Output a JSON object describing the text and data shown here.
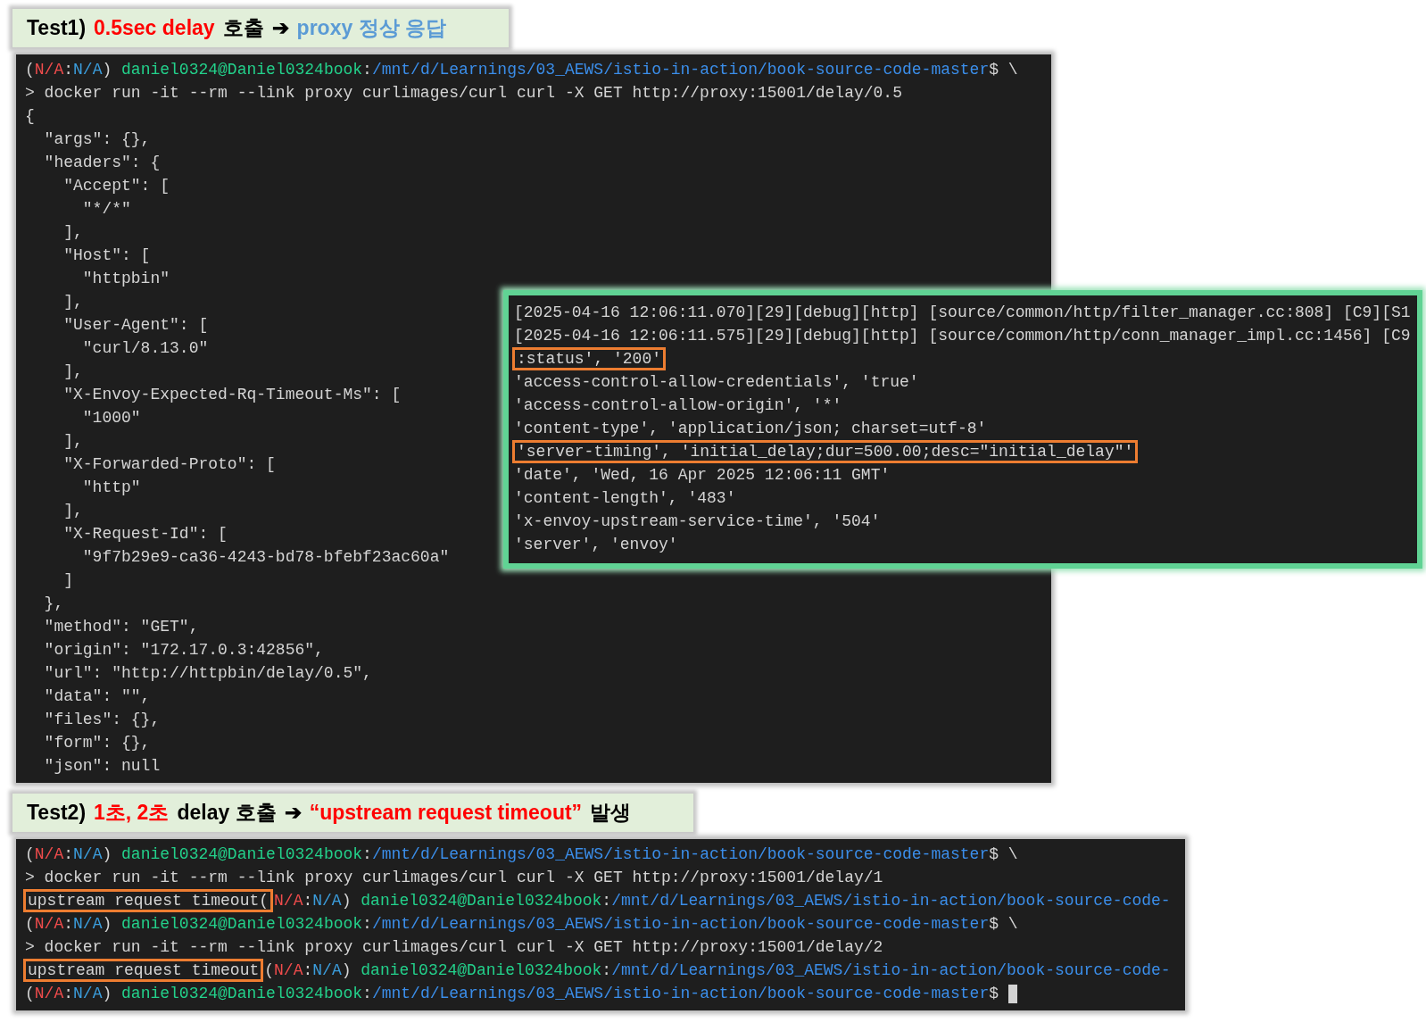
{
  "sections": [
    {
      "caption": [
        {
          "text": "Test1)",
          "color": "#000000"
        },
        {
          "text": "0.5sec delay",
          "color": "#ff0000"
        },
        {
          "text": "호출",
          "color": "#000000"
        },
        {
          "text": "➔",
          "color": "#000000"
        },
        {
          "text": "proxy 정상 응답",
          "color": "#5b9bd5"
        }
      ],
      "terminal": {
        "lines": [
          [
            {
              "text": "(",
              "kind": "text"
            },
            {
              "text": "N/A",
              "kind": "na_red"
            },
            {
              "text": ":",
              "kind": "text"
            },
            {
              "text": "N/A",
              "kind": "na_blue"
            },
            {
              "text": ") ",
              "kind": "text"
            },
            {
              "text": "daniel0324@Daniel0324book",
              "kind": "user"
            },
            {
              "text": ":",
              "kind": "text"
            },
            {
              "text": "/mnt/d/Learnings/03_AEWS/istio-in-action/book-source-code-master",
              "kind": "path"
            },
            {
              "text": "$ \\",
              "kind": "text"
            }
          ],
          [
            {
              "text": "> docker run -it --rm --link proxy curlimages/curl curl -X GET http://proxy:15001/delay/0.5",
              "kind": "text"
            }
          ],
          [
            {
              "text": "{",
              "kind": "text"
            }
          ],
          [
            {
              "text": "  \"args\": {},",
              "kind": "text"
            }
          ],
          [
            {
              "text": "  \"headers\": {",
              "kind": "text"
            }
          ],
          [
            {
              "text": "    \"Accept\": [",
              "kind": "text"
            }
          ],
          [
            {
              "text": "      \"*/*\"",
              "kind": "text"
            }
          ],
          [
            {
              "text": "    ],",
              "kind": "text"
            }
          ],
          [
            {
              "text": "    \"Host\": [",
              "kind": "text"
            }
          ],
          [
            {
              "text": "      \"httpbin\"",
              "kind": "text"
            }
          ],
          [
            {
              "text": "    ],",
              "kind": "text"
            }
          ],
          [
            {
              "text": "    \"User-Agent\": [",
              "kind": "text"
            }
          ],
          [
            {
              "text": "      \"curl/8.13.0\"",
              "kind": "text"
            }
          ],
          [
            {
              "text": "    ],",
              "kind": "text"
            }
          ],
          [
            {
              "text": "    \"X-Envoy-Expected-Rq-Timeout-Ms\": [",
              "kind": "text"
            }
          ],
          [
            {
              "text": "      \"1000\"",
              "kind": "text"
            }
          ],
          [
            {
              "text": "    ],",
              "kind": "text"
            }
          ],
          [
            {
              "text": "    \"X-Forwarded-Proto\": [",
              "kind": "text"
            }
          ],
          [
            {
              "text": "      \"http\"",
              "kind": "text"
            }
          ],
          [
            {
              "text": "    ],",
              "kind": "text"
            }
          ],
          [
            {
              "text": "    \"X-Request-Id\": [",
              "kind": "text"
            }
          ],
          [
            {
              "text": "      \"9f7b29e9-ca36-4243-bd78-bfebf23ac60a\"",
              "kind": "text"
            }
          ],
          [
            {
              "text": "    ]",
              "kind": "text"
            }
          ],
          [
            {
              "text": "  },",
              "kind": "text"
            }
          ],
          [
            {
              "text": "  \"method\": \"GET\",",
              "kind": "text"
            }
          ],
          [
            {
              "text": "  \"origin\": \"172.17.0.3:42856\",",
              "kind": "text"
            }
          ],
          [
            {
              "text": "  \"url\": \"http://httpbin/delay/0.5\",",
              "kind": "text"
            }
          ],
          [
            {
              "text": "  \"data\": \"\",",
              "kind": "text"
            }
          ],
          [
            {
              "text": "  \"files\": {},",
              "kind": "text"
            }
          ],
          [
            {
              "text": "  \"form\": {},",
              "kind": "text"
            }
          ],
          [
            {
              "text": "  \"json\": null",
              "kind": "text"
            }
          ]
        ]
      },
      "log_panel": {
        "lines": [
          [
            {
              "text": "[2025-04-16 12:06:11.070][29][debug][http] [source/common/http/filter_manager.cc:808] [C9][S1",
              "kind": "text"
            }
          ],
          [
            {
              "text": "[2025-04-16 12:06:11.575][29][debug][http] [source/common/http/conn_manager_impl.cc:1456] [C9",
              "kind": "text"
            }
          ],
          [
            {
              "text": ":status', '200'",
              "kind": "boxed"
            }
          ],
          [
            {
              "text": "'access-control-allow-credentials', 'true'",
              "kind": "text"
            }
          ],
          [
            {
              "text": "'access-control-allow-origin', '*'",
              "kind": "text"
            }
          ],
          [
            {
              "text": "'content-type', 'application/json; charset=utf-8'",
              "kind": "text"
            }
          ],
          [
            {
              "text": "'server-timing', 'initial_delay;dur=500.00;desc=\"initial_delay\"'",
              "kind": "boxed"
            }
          ],
          [
            {
              "text": "'date', 'Wed, 16 Apr 2025 12:06:11 GMT'",
              "kind": "text"
            }
          ],
          [
            {
              "text": "'content-length', '483'",
              "kind": "text"
            }
          ],
          [
            {
              "text": "'x-envoy-upstream-service-time', '504'",
              "kind": "text"
            }
          ],
          [
            {
              "text": "'server', 'envoy'",
              "kind": "text"
            }
          ]
        ]
      }
    },
    {
      "caption": [
        {
          "text": "Test2)",
          "color": "#000000"
        },
        {
          "text": "1초, 2초",
          "color": "#ff0000"
        },
        {
          "text": "delay 호출",
          "color": "#000000"
        },
        {
          "text": "➔",
          "color": "#000000"
        },
        {
          "text": "“upstream request timeout”",
          "color": "#ff0000"
        },
        {
          "text": "발생",
          "color": "#000000"
        }
      ],
      "terminal": {
        "cursor": true,
        "lines": [
          [
            {
              "text": "(",
              "kind": "text"
            },
            {
              "text": "N/A",
              "kind": "na_red"
            },
            {
              "text": ":",
              "kind": "text"
            },
            {
              "text": "N/A",
              "kind": "na_blue"
            },
            {
              "text": ") ",
              "kind": "text"
            },
            {
              "text": "daniel0324@Daniel0324book",
              "kind": "user"
            },
            {
              "text": ":",
              "kind": "text"
            },
            {
              "text": "/mnt/d/Learnings/03_AEWS/istio-in-action/book-source-code-master",
              "kind": "path"
            },
            {
              "text": "$ \\",
              "kind": "text"
            }
          ],
          [
            {
              "text": "> docker run -it --rm --link proxy curlimages/curl curl -X GET http://proxy:15001/delay/1",
              "kind": "text"
            }
          ],
          [
            {
              "text": "upstream request timeout(",
              "kind": "boxed"
            },
            {
              "text": "N/A",
              "kind": "na_red"
            },
            {
              "text": ":",
              "kind": "text"
            },
            {
              "text": "N/A",
              "kind": "na_blue"
            },
            {
              "text": ") ",
              "kind": "text"
            },
            {
              "text": "daniel0324@Daniel0324book",
              "kind": "user"
            },
            {
              "text": ":",
              "kind": "text"
            },
            {
              "text": "/mnt/d/Learnings/03_AEWS/istio-in-action/book-source-code-",
              "kind": "path"
            }
          ],
          [
            {
              "text": "(",
              "kind": "text"
            },
            {
              "text": "N/A",
              "kind": "na_red"
            },
            {
              "text": ":",
              "kind": "text"
            },
            {
              "text": "N/A",
              "kind": "na_blue"
            },
            {
              "text": ") ",
              "kind": "text"
            },
            {
              "text": "daniel0324@Daniel0324book",
              "kind": "user"
            },
            {
              "text": ":",
              "kind": "text"
            },
            {
              "text": "/mnt/d/Learnings/03_AEWS/istio-in-action/book-source-code-master",
              "kind": "path"
            },
            {
              "text": "$ \\",
              "kind": "text"
            }
          ],
          [
            {
              "text": "> docker run -it --rm --link proxy curlimages/curl curl -X GET http://proxy:15001/delay/2",
              "kind": "text"
            }
          ],
          [
            {
              "text": "upstream request timeout",
              "kind": "boxed"
            },
            {
              "text": "(",
              "kind": "text"
            },
            {
              "text": "N/A",
              "kind": "na_red"
            },
            {
              "text": ":",
              "kind": "text"
            },
            {
              "text": "N/A",
              "kind": "na_blue"
            },
            {
              "text": ") ",
              "kind": "text"
            },
            {
              "text": "daniel0324@Daniel0324book",
              "kind": "user"
            },
            {
              "text": ":",
              "kind": "text"
            },
            {
              "text": "/mnt/d/Learnings/03_AEWS/istio-in-action/book-source-code-",
              "kind": "path"
            }
          ],
          [
            {
              "text": "(",
              "kind": "text"
            },
            {
              "text": "N/A",
              "kind": "na_red"
            },
            {
              "text": ":",
              "kind": "text"
            },
            {
              "text": "N/A",
              "kind": "na_blue"
            },
            {
              "text": ") ",
              "kind": "text"
            },
            {
              "text": "daniel0324@Daniel0324book",
              "kind": "user"
            },
            {
              "text": ":",
              "kind": "text"
            },
            {
              "text": "/mnt/d/Learnings/03_AEWS/istio-in-action/book-source-code-master",
              "kind": "path"
            },
            {
              "text": "$ ",
              "kind": "text"
            }
          ]
        ]
      }
    }
  ]
}
